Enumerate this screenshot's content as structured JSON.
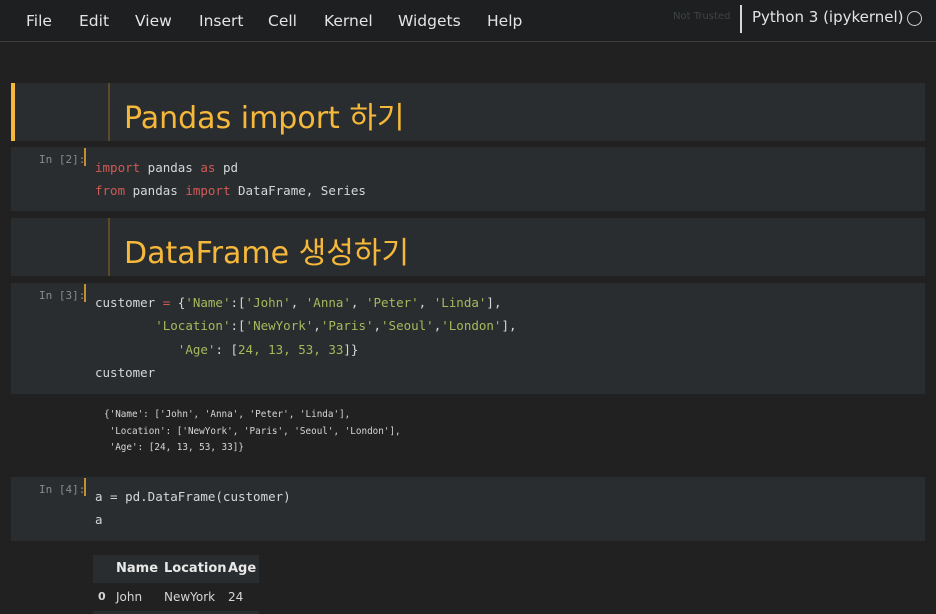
{
  "menu": {
    "items": [
      "File",
      "Edit",
      "View",
      "Insert",
      "Cell",
      "Kernel",
      "Widgets",
      "Help"
    ],
    "trust_status": "Not Trusted",
    "kernel": "Python 3 (ipykernel)"
  },
  "cells": {
    "h1": "Pandas import 하기",
    "in2_prompt": "In [2]:",
    "in2_line1": {
      "kw1": "import",
      "t1": " pandas ",
      "kw2": "as",
      "t2": " pd"
    },
    "in2_line2": {
      "kw1": "from",
      "t1": " pandas ",
      "kw2": "import",
      "t2": " DataFrame, Series"
    },
    "h2": "DataFrame 생성하기",
    "in3_prompt": "In [3]:",
    "in3_code": {
      "l1_a": "customer ",
      "l1_eq": "=",
      "l1_b": " {",
      "l1_s1": "'Name'",
      "l1_c": ":[",
      "l1_s2": "'John'",
      "l1_d": ", ",
      "l1_s3": "'Anna'",
      "l1_e": ", ",
      "l1_s4": "'Peter'",
      "l1_f": ", ",
      "l1_s5": "'Linda'",
      "l1_g": "],",
      "l2_pad": "        ",
      "l2_s1": "'Location'",
      "l2_a": ":[",
      "l2_s2": "'NewYork'",
      "l2_b": ",",
      "l2_s3": "'Paris'",
      "l2_c": ",",
      "l2_s4": "'Seoul'",
      "l2_d": ",",
      "l2_s5": "'London'",
      "l2_e": "],",
      "l3_pad": "           ",
      "l3_s1": "'Age'",
      "l3_a": ": [",
      "l3_n": "24, 13, 53, 33",
      "l3_b": "]}",
      "l4": "customer"
    },
    "out3": [
      "{'Name': ['John', 'Anna', 'Peter', 'Linda'],",
      " 'Location': ['NewYork', 'Paris', 'Seoul', 'London'],",
      " 'Age': [24, 13, 53, 33]}"
    ],
    "in4_prompt": "In [4]:",
    "in4_l1": "a = pd.DataFrame(customer)",
    "in4_l2": "a"
  },
  "dataframe": {
    "columns": [
      "Name",
      "Location",
      "Age"
    ],
    "rows": [
      {
        "index": "0",
        "Name": "John",
        "Location": "NewYork",
        "Age": "24"
      }
    ]
  }
}
